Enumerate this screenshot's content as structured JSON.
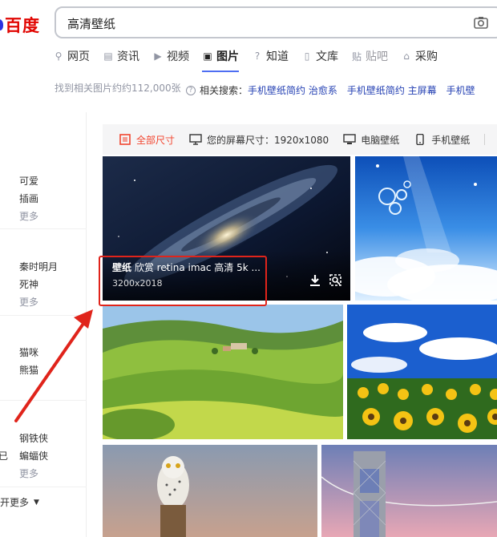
{
  "logo": {
    "text": "百度"
  },
  "search": {
    "query": "高清壁纸"
  },
  "nav": [
    {
      "label": "网页",
      "icon": "search-icon",
      "glyph": "⚲"
    },
    {
      "label": "资讯",
      "icon": "news-icon",
      "glyph": "▤"
    },
    {
      "label": "视频",
      "icon": "video-icon",
      "glyph": "▶"
    },
    {
      "label": "图片",
      "icon": "image-icon",
      "glyph": "▣",
      "active": true
    },
    {
      "label": "知道",
      "icon": "question-icon",
      "glyph": "?"
    },
    {
      "label": "文库",
      "icon": "doc-icon",
      "glyph": "▯"
    },
    {
      "label": "贴吧",
      "icon": "tieba-icon",
      "glyph": "贴",
      "faded": true
    },
    {
      "label": "采购",
      "icon": "shop-icon",
      "glyph": "⌂"
    }
  ],
  "results": {
    "count_text": "找到相关图片约约112,000张"
  },
  "related": {
    "label": "相关搜索：",
    "links": [
      "手机壁纸简约 治愈系",
      "手机壁纸简约 主屏幕",
      "手机壁"
    ]
  },
  "sidebar": {
    "groups": [
      {
        "items": [
          "可爱",
          "插画"
        ],
        "more": "更多"
      },
      {
        "items": [
          "秦时明月",
          "死神"
        ],
        "more": "更多"
      },
      {
        "items": [
          "猫咪",
          "熊猫"
        ],
        "more": null
      },
      {
        "items": [
          "钢铁侠",
          "蝙蝠侠"
        ],
        "prefix": "已",
        "more": "更多"
      }
    ],
    "footer": "开更多"
  },
  "filters": {
    "all_sizes": "全部尺寸",
    "screen_size": "您的屏幕尺寸：1920x1080",
    "pc": "电脑壁纸",
    "phone": "手机壁纸"
  },
  "images": [
    {
      "name": "galaxy",
      "caption_bold": "壁纸",
      "caption": " 欣赏 retina imac 高清 5k ...",
      "size": "3200x2018"
    },
    {
      "name": "sky-bubbles"
    },
    {
      "name": "green-hills"
    },
    {
      "name": "sunflowers"
    },
    {
      "name": "owl"
    },
    {
      "name": "bridge"
    }
  ],
  "colors": {
    "accent": "#4e6ef2",
    "brand_red": "#e10602",
    "link": "#2440b3",
    "annotation": "#e0241b"
  }
}
